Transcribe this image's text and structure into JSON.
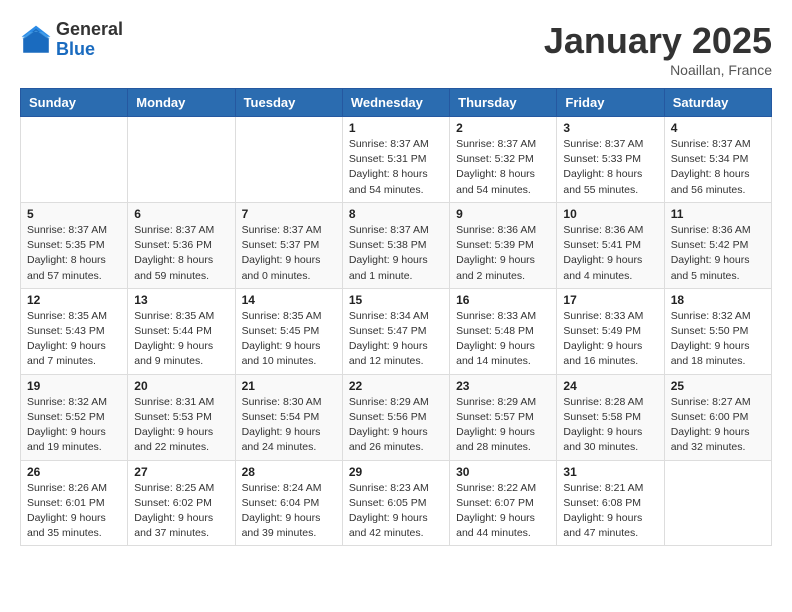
{
  "logo": {
    "general": "General",
    "blue": "Blue"
  },
  "title": "January 2025",
  "location": "Noaillan, France",
  "days_header": [
    "Sunday",
    "Monday",
    "Tuesday",
    "Wednesday",
    "Thursday",
    "Friday",
    "Saturday"
  ],
  "weeks": [
    [
      {
        "day": "",
        "info": ""
      },
      {
        "day": "",
        "info": ""
      },
      {
        "day": "",
        "info": ""
      },
      {
        "day": "1",
        "info": "Sunrise: 8:37 AM\nSunset: 5:31 PM\nDaylight: 8 hours\nand 54 minutes."
      },
      {
        "day": "2",
        "info": "Sunrise: 8:37 AM\nSunset: 5:32 PM\nDaylight: 8 hours\nand 54 minutes."
      },
      {
        "day": "3",
        "info": "Sunrise: 8:37 AM\nSunset: 5:33 PM\nDaylight: 8 hours\nand 55 minutes."
      },
      {
        "day": "4",
        "info": "Sunrise: 8:37 AM\nSunset: 5:34 PM\nDaylight: 8 hours\nand 56 minutes."
      }
    ],
    [
      {
        "day": "5",
        "info": "Sunrise: 8:37 AM\nSunset: 5:35 PM\nDaylight: 8 hours\nand 57 minutes."
      },
      {
        "day": "6",
        "info": "Sunrise: 8:37 AM\nSunset: 5:36 PM\nDaylight: 8 hours\nand 59 minutes."
      },
      {
        "day": "7",
        "info": "Sunrise: 8:37 AM\nSunset: 5:37 PM\nDaylight: 9 hours\nand 0 minutes."
      },
      {
        "day": "8",
        "info": "Sunrise: 8:37 AM\nSunset: 5:38 PM\nDaylight: 9 hours\nand 1 minute."
      },
      {
        "day": "9",
        "info": "Sunrise: 8:36 AM\nSunset: 5:39 PM\nDaylight: 9 hours\nand 2 minutes."
      },
      {
        "day": "10",
        "info": "Sunrise: 8:36 AM\nSunset: 5:41 PM\nDaylight: 9 hours\nand 4 minutes."
      },
      {
        "day": "11",
        "info": "Sunrise: 8:36 AM\nSunset: 5:42 PM\nDaylight: 9 hours\nand 5 minutes."
      }
    ],
    [
      {
        "day": "12",
        "info": "Sunrise: 8:35 AM\nSunset: 5:43 PM\nDaylight: 9 hours\nand 7 minutes."
      },
      {
        "day": "13",
        "info": "Sunrise: 8:35 AM\nSunset: 5:44 PM\nDaylight: 9 hours\nand 9 minutes."
      },
      {
        "day": "14",
        "info": "Sunrise: 8:35 AM\nSunset: 5:45 PM\nDaylight: 9 hours\nand 10 minutes."
      },
      {
        "day": "15",
        "info": "Sunrise: 8:34 AM\nSunset: 5:47 PM\nDaylight: 9 hours\nand 12 minutes."
      },
      {
        "day": "16",
        "info": "Sunrise: 8:33 AM\nSunset: 5:48 PM\nDaylight: 9 hours\nand 14 minutes."
      },
      {
        "day": "17",
        "info": "Sunrise: 8:33 AM\nSunset: 5:49 PM\nDaylight: 9 hours\nand 16 minutes."
      },
      {
        "day": "18",
        "info": "Sunrise: 8:32 AM\nSunset: 5:50 PM\nDaylight: 9 hours\nand 18 minutes."
      }
    ],
    [
      {
        "day": "19",
        "info": "Sunrise: 8:32 AM\nSunset: 5:52 PM\nDaylight: 9 hours\nand 19 minutes."
      },
      {
        "day": "20",
        "info": "Sunrise: 8:31 AM\nSunset: 5:53 PM\nDaylight: 9 hours\nand 22 minutes."
      },
      {
        "day": "21",
        "info": "Sunrise: 8:30 AM\nSunset: 5:54 PM\nDaylight: 9 hours\nand 24 minutes."
      },
      {
        "day": "22",
        "info": "Sunrise: 8:29 AM\nSunset: 5:56 PM\nDaylight: 9 hours\nand 26 minutes."
      },
      {
        "day": "23",
        "info": "Sunrise: 8:29 AM\nSunset: 5:57 PM\nDaylight: 9 hours\nand 28 minutes."
      },
      {
        "day": "24",
        "info": "Sunrise: 8:28 AM\nSunset: 5:58 PM\nDaylight: 9 hours\nand 30 minutes."
      },
      {
        "day": "25",
        "info": "Sunrise: 8:27 AM\nSunset: 6:00 PM\nDaylight: 9 hours\nand 32 minutes."
      }
    ],
    [
      {
        "day": "26",
        "info": "Sunrise: 8:26 AM\nSunset: 6:01 PM\nDaylight: 9 hours\nand 35 minutes."
      },
      {
        "day": "27",
        "info": "Sunrise: 8:25 AM\nSunset: 6:02 PM\nDaylight: 9 hours\nand 37 minutes."
      },
      {
        "day": "28",
        "info": "Sunrise: 8:24 AM\nSunset: 6:04 PM\nDaylight: 9 hours\nand 39 minutes."
      },
      {
        "day": "29",
        "info": "Sunrise: 8:23 AM\nSunset: 6:05 PM\nDaylight: 9 hours\nand 42 minutes."
      },
      {
        "day": "30",
        "info": "Sunrise: 8:22 AM\nSunset: 6:07 PM\nDaylight: 9 hours\nand 44 minutes."
      },
      {
        "day": "31",
        "info": "Sunrise: 8:21 AM\nSunset: 6:08 PM\nDaylight: 9 hours\nand 47 minutes."
      },
      {
        "day": "",
        "info": ""
      }
    ]
  ]
}
